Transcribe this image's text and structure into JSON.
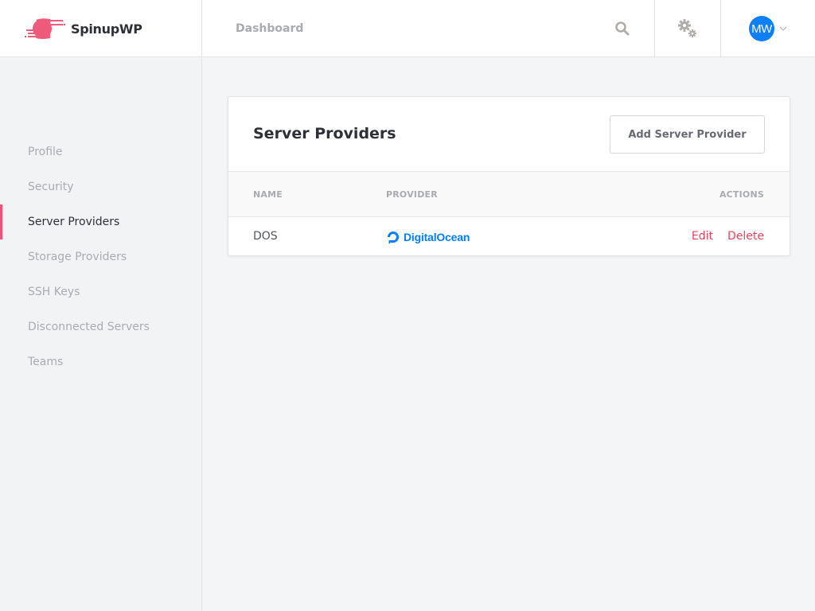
{
  "header": {
    "logo_text": "SpinupWP",
    "nav_dashboard": "Dashboard",
    "user_initials": "MW",
    "icons": [
      "search-icon",
      "gear-icon",
      "chevron-down-icon"
    ]
  },
  "sidebar": {
    "items": [
      {
        "label": "Profile",
        "active": false
      },
      {
        "label": "Security",
        "active": false
      },
      {
        "label": "Server Providers",
        "active": true
      },
      {
        "label": "Storage Providers",
        "active": false
      },
      {
        "label": "SSH Keys",
        "active": false
      },
      {
        "label": "Disconnected Servers",
        "active": false
      },
      {
        "label": "Teams",
        "active": false
      }
    ]
  },
  "main": {
    "title": "Server Providers",
    "add_button": "Add Server Provider",
    "table": {
      "columns": [
        "NAME",
        "PROVIDER",
        "ACTIONS"
      ],
      "rows": [
        {
          "name": "DOS",
          "provider": "DigitalOcean",
          "actions": [
            "Edit",
            "Delete"
          ]
        }
      ]
    }
  },
  "colors": {
    "accent": "#e9547a",
    "action": "#e9445f",
    "digitalocean": "#0080ff",
    "avatar": "#0d7ff8"
  }
}
